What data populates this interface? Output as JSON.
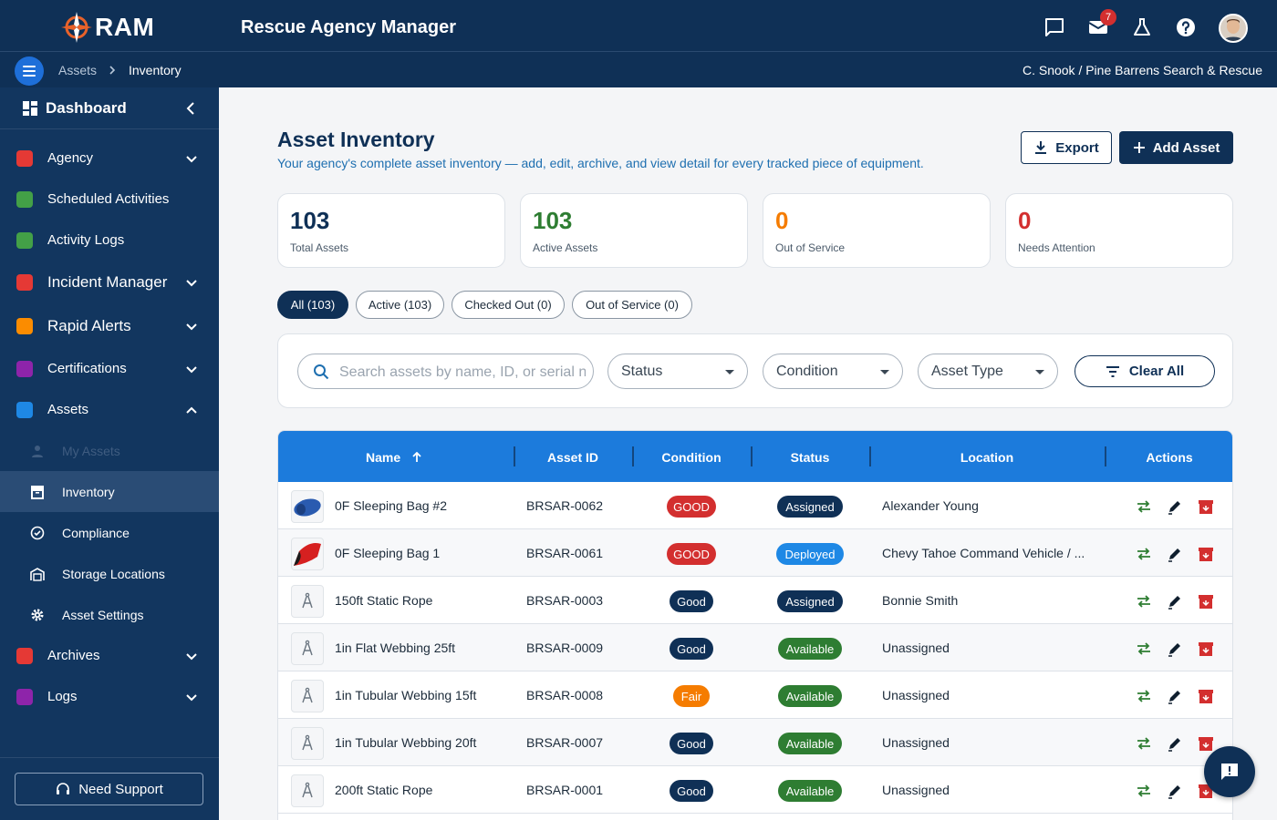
{
  "app": {
    "logo_text": "RAM",
    "title": "Rescue Agency Manager",
    "mail_count": "7"
  },
  "breadcrumb": {
    "parent": "Assets",
    "current": "Inventory",
    "separator": "›"
  },
  "user_org": "C. Snook / Pine Barrens Search & Rescue",
  "sidebar": {
    "dashboard": "Dashboard",
    "items": [
      {
        "label": "Agency",
        "icon": "shield-icon",
        "color": "#e53935"
      },
      {
        "label": "Scheduled Activities",
        "icon": "calendar-icon",
        "color": "#43a047"
      },
      {
        "label": "Activity Logs",
        "icon": "log-icon",
        "color": "#43a047"
      },
      {
        "label": "Incident Manager",
        "icon": "warning-icon",
        "color": "#e53935"
      },
      {
        "label": "Rapid Alerts",
        "icon": "alarm-icon",
        "color": "#fb8c00"
      },
      {
        "label": "Certifications",
        "icon": "certificate-icon",
        "color": "#8e24aa"
      },
      {
        "label": "Assets",
        "icon": "assets-icon",
        "color": "#1e88e5"
      }
    ],
    "asset_sub": [
      "My Assets",
      "Inventory",
      "Compliance",
      "Storage Locations",
      "Asset Settings"
    ],
    "bottom_items": [
      {
        "label": "Archives",
        "icon": "archive-icon",
        "color": "#e53935"
      },
      {
        "label": "Logs",
        "icon": "logs-icon",
        "color": "#8e24aa"
      }
    ],
    "support": "Need Support"
  },
  "page": {
    "title": "Asset Inventory",
    "subtitle": "Your agency's complete asset inventory — add, edit, archive, and view detail for every tracked piece of equipment.",
    "export": "Export",
    "add": "Add Asset"
  },
  "stats": [
    {
      "value": "103",
      "label": "Total Assets",
      "color": "#0f3056"
    },
    {
      "value": "103",
      "label": "Active Assets",
      "color": "#2e7d32"
    },
    {
      "value": "0",
      "label": "Out of Service",
      "color": "#f57c00"
    },
    {
      "value": "0",
      "label": "Needs Attention",
      "color": "#d32f2f"
    }
  ],
  "pills": [
    "All (103)",
    "Active (103)",
    "Checked Out (0)",
    "Out of Service (0)"
  ],
  "filters": {
    "search_placeholder": "Search assets by name, ID, or serial n",
    "status": "Status",
    "condition": "Condition",
    "asset_type": "Asset Type",
    "clear": "Clear All"
  },
  "table": {
    "headers": [
      "Name",
      "Asset ID",
      "Condition",
      "Status",
      "Location",
      "Actions"
    ],
    "rows": [
      {
        "name": "0F Sleeping Bag #2",
        "id": "BRSAR-0062",
        "condition": "GOOD",
        "status": "Assigned",
        "location": "Alexander Young",
        "thumb": "blue-bag"
      },
      {
        "name": "0F Sleeping Bag 1",
        "id": "BRSAR-0061",
        "condition": "GOOD",
        "status": "Deployed",
        "location": "Chevy Tahoe Command Vehicle / ...",
        "thumb": "red-bag"
      },
      {
        "name": "150ft Static Rope",
        "id": "BRSAR-0003",
        "condition": "Good",
        "status": "Assigned",
        "location": "Bonnie Smith",
        "thumb": "tool"
      },
      {
        "name": "1in Flat Webbing 25ft",
        "id": "BRSAR-0009",
        "condition": "Good",
        "status": "Available",
        "location": "Unassigned",
        "thumb": "tool"
      },
      {
        "name": "1in Tubular Webbing 15ft",
        "id": "BRSAR-0008",
        "condition": "Fair",
        "status": "Available",
        "location": "Unassigned",
        "thumb": "tool"
      },
      {
        "name": "1in Tubular Webbing 20ft",
        "id": "BRSAR-0007",
        "condition": "Good",
        "status": "Available",
        "location": "Unassigned",
        "thumb": "tool"
      },
      {
        "name": "200ft Static Rope",
        "id": "BRSAR-0001",
        "condition": "Good",
        "status": "Available",
        "location": "Unassigned",
        "thumb": "tool"
      }
    ]
  },
  "colors": {
    "navy": "#0f3056",
    "table_header": "#1c7bdc",
    "good_upper": "#d32f2f",
    "good": "#0f3056",
    "fair": "#f57c00",
    "assigned": "#0f3056",
    "deployed": "#1e88e5",
    "available": "#2e7d32"
  }
}
